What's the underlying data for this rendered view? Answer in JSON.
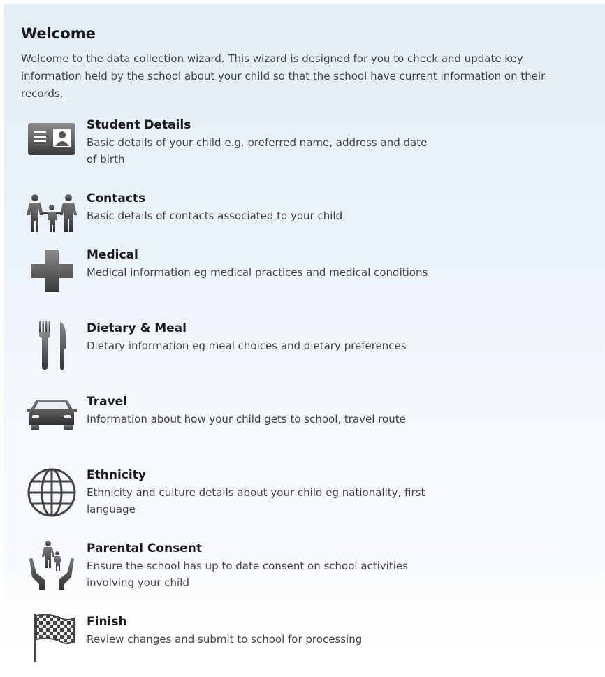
{
  "welcome": {
    "title": "Welcome",
    "intro": "Welcome to the data collection wizard. This wizard is designed for you to check and update key information held by the school about your child so that the school have current information on their records."
  },
  "steps": [
    {
      "title": "Student Details",
      "description": "Basic details of your child e.g. preferred name, address and date of birth",
      "icon": "id-card-icon"
    },
    {
      "title": "Contacts",
      "description": "Basic details of contacts associated to your child",
      "icon": "family-icon"
    },
    {
      "title": "Medical",
      "description": "Medical information eg medical practices and medical conditions",
      "icon": "medical-cross-icon"
    },
    {
      "title": "Dietary & Meal",
      "description": "Dietary information eg meal choices and dietary preferences",
      "icon": "fork-knife-icon"
    },
    {
      "title": "Travel",
      "description": "Information about how your child gets to school, travel route",
      "icon": "car-icon"
    },
    {
      "title": "Ethnicity",
      "description": "Ethnicity and culture details about your child eg nationality, first language",
      "icon": "globe-icon"
    },
    {
      "title": "Parental Consent",
      "description": "Ensure the school has up to date consent on school activities involving your child",
      "icon": "hands-consent-icon"
    },
    {
      "title": "Finish",
      "description": "Review changes and submit to school for processing",
      "icon": "checkered-flag-icon"
    }
  ],
  "colors": {
    "icon_dark": "#3f3f3f",
    "icon_light": "#8a8a8a",
    "heading": "#1a1a1a",
    "body_text": "#444444"
  }
}
